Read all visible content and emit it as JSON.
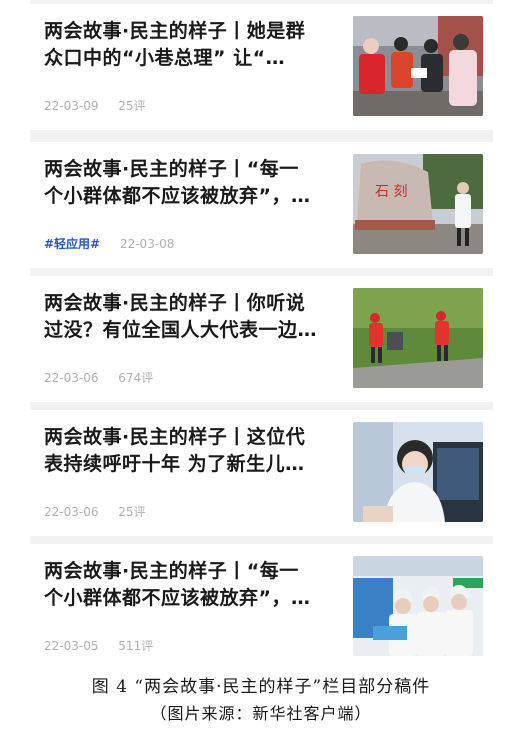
{
  "articles": [
    {
      "title_line1": "两会故事·民主的样子丨她是群",
      "title_line2": "众口中的“小巷总理” 让“…",
      "tag": "",
      "date": "22-03-09",
      "comments": "25评",
      "image_icon": "photo-community-workers"
    },
    {
      "title_line1": "两会故事·民主的样子丨“每一",
      "title_line2": "个小群体都不应该被放弃”，…",
      "tag": "#轻应用#",
      "date": "22-03-08",
      "comments": "",
      "image_icon": "photo-stone-monument"
    },
    {
      "title_line1": "两会故事·民主的样子丨你听说",
      "title_line2": "过没？有位全国人大代表一边…",
      "tag": "",
      "date": "22-03-06",
      "comments": "674评",
      "image_icon": "photo-sanitation-workers"
    },
    {
      "title_line1": "两会故事·民主的样子丨这位代",
      "title_line2": "表持续呼吁十年 为了新生儿…",
      "tag": "",
      "date": "22-03-06",
      "comments": "25评",
      "image_icon": "photo-doctor-computer"
    },
    {
      "title_line1": "两会故事·民主的样子丨“每一",
      "title_line2": "个小群体都不应该被放弃”，…",
      "tag": "",
      "date": "22-03-05",
      "comments": "511评",
      "image_icon": "photo-medical-staff"
    }
  ],
  "caption": {
    "line1": "图 4 “两会故事·民主的样子”栏目部分稿件",
    "line2": "（图片来源：新华社客户端）"
  },
  "colors": {
    "tag": "#2a56b8",
    "meta": "#b0b0b0",
    "feed_bg": "#f2f2f2"
  }
}
